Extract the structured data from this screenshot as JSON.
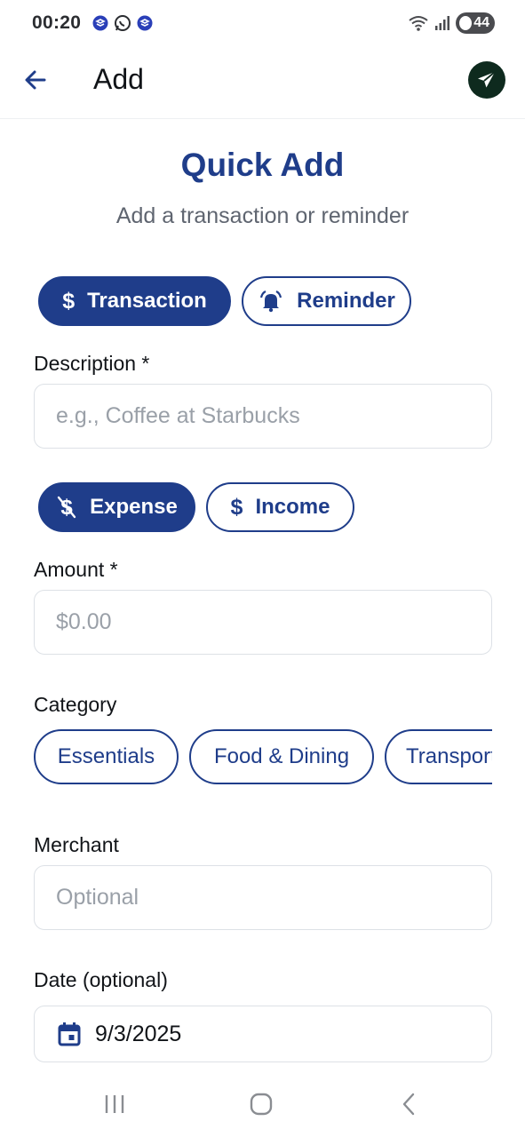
{
  "status_bar": {
    "time": "00:20",
    "battery": "44",
    "left_icons": [
      "layers-icon",
      "whatsapp-icon",
      "layers-icon"
    ],
    "right_icons": [
      "wifi-icon",
      "signal-icon",
      "battery-icon"
    ]
  },
  "header": {
    "title": "Add",
    "back_icon": "arrow-left-icon",
    "send_icon": "send-icon"
  },
  "main": {
    "title": "Quick Add",
    "subtitle": "Add a transaction or reminder",
    "mode_tabs": [
      {
        "label": "Transaction",
        "icon": "dollar-icon",
        "selected": true
      },
      {
        "label": "Reminder",
        "icon": "bell-icon",
        "selected": false
      }
    ],
    "description": {
      "label": "Description *",
      "placeholder": "e.g., Coffee at Starbucks",
      "value": ""
    },
    "type_tabs": [
      {
        "label": "Expense",
        "icon": "dollar-off-icon",
        "selected": true
      },
      {
        "label": "Income",
        "icon": "dollar-icon",
        "selected": false
      }
    ],
    "amount": {
      "label": "Amount *",
      "placeholder": "$0.00",
      "value": ""
    },
    "category": {
      "label": "Category",
      "chips": [
        "Essentials",
        "Food & Dining",
        "Transport"
      ]
    },
    "merchant": {
      "label": "Merchant",
      "placeholder": "Optional",
      "value": ""
    },
    "date": {
      "label": "Date (optional)",
      "value": "9/3/2025",
      "icon": "calendar-icon"
    }
  },
  "nav_bar": {
    "icons": [
      "recent-apps-icon",
      "home-icon",
      "back-icon"
    ]
  },
  "colors": {
    "primary": "#1f3d8a",
    "text": "#111418",
    "muted": "#5f6570",
    "placeholder": "#9aa0a8",
    "border": "#dde1e6",
    "send_button": "#0e2a1e"
  }
}
